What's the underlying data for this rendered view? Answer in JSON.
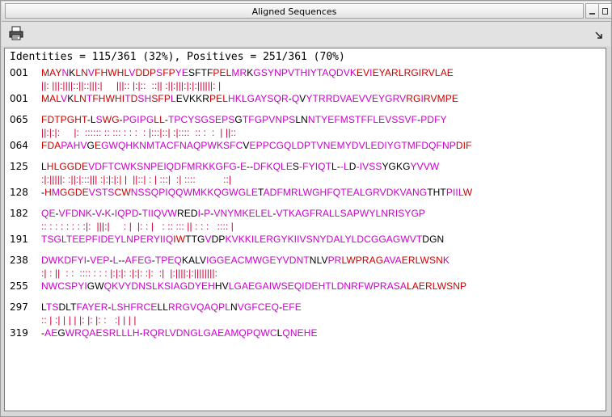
{
  "window": {
    "title": "Aligned Sequences"
  },
  "icons": {
    "print": "printer-icon",
    "minimize": "minimize-icon",
    "maximize": "maximize-icon",
    "close": "close-icon",
    "corner": "dock-arrow-icon"
  },
  "colors": {
    "identical": "#cc0000",
    "similar": "#cc00cc",
    "other": "#000000",
    "match_line": "#cc0033"
  },
  "summary": "Identities = 115/361 (32%), Positives = 251/361 (70%)",
  "blocks": [
    {
      "q_start": "001",
      "q_seq": "MAYNKLNVFHWHLVDDPSFPYESFTFPELMRKGSYNPVTHIYTAQDVKEVIEYARLRGIRVLAE",
      "q_cls": "RRRMBRRMRRRRRMRRRMRRMMBBBBRRRMMBMMMMMMMMMMMMMMMMRRMRRRRRRRRRRRRR",
      "match": "||: |||:||||::||::|||:|     |||:: |:|::  ::|| :||:|||:|:|:||||||: |",
      "s_start": "001",
      "s_seq": "MALVKLNTFHWHITDSHSFPLEVKKRPELHKLGAYSQR-QVYTRRDVAEVVEYGRVRGIRVMPE",
      "s_cls": "RRRMBRRMRRRRRMRMMRRRMBBBBBRRRMMMMMMMMMBMBMMMMMMMMMMMMMMMRRMRRRRR"
    },
    {
      "q_start": "065",
      "q_seq": "FDTPGHT-LSWG-PGIPGLL-TPCYSGSEPSGTFGPVNPSLNNTYEFMSTFFLEVSSVF-PDFY",
      "q_cls": "RRRRRRRBBMRRBMMMMMRRBMMMMMMMMMMBMMMMMMMMBBMMMMMMMMMMMMMMMMMBMMMM",
      "match": "||:|:|:     |:  :::::: :: ::: : : :  : |:::|::| :|::::  :: :  :  | ||::",
      "s_start": "064",
      "s_seq": "FDAPAHVGEGWQHKNMTACFNAQPWKSFCVEPPCGQLDPTVNEMYDVLEDIYGTMFDQFNPDIF",
      "s_cls": "RRRMMMMBRMMMMMMMMMMMMMMMMMMMMBMMMMMMMMMMMMMMMMMMMMMMMMMMMMMMMRRR"
    },
    {
      "q_start": "125",
      "q_seq": "LHLGGDEVDFTCWKSNPEIQDFMRKKGFG-E--DFKQLES-FYIQTL--LD-IVSSYGKGYVVW",
      "q_cls": "BRRRRRRMMMMMMMMMMMMMMMMMMMMMMBMBBMMMMMMBMMMMMMBBMMBMMMMMBBBBMMMM",
      "match": ":|:|||||: :||:|:::||| :|:|:|:| |  ||::| : | :::|  :| ::::          ::|",
      "s_start": "128",
      "s_seq": "-HMGGDEVSTSCWNSSQPIQQWMKKQGWGLETADFMRLWGHFQTEALGRVDKVANGTHTPIILW",
      "s_cls": "BRMRRRRMMMMRRMMMMMMMMMMMMMMMMMMBMMMMMMMMMMMMMMMMMMMMMMMMBBBMMMMR"
    },
    {
      "q_start": "182",
      "q_seq": "QE-VFDNK-V-K-IQPD-TIIQVWREDI-P-VNYMKELEL-VTKAGFRALLSAPWYLNRISYGP",
      "q_cls": "MMBMMMMMBMBMBMMMMBMMMMMMBBBMBMBMMMMMMMMMBMMMMMMMMMMMMMMMMMMMMMMM",
      "match": ":: : : : : : : :|:  |||:|     : |  |: : |   : :: ::: || : : :   :::: |",
      "s_start": "191",
      "s_seq": "TSGLTEEPFIDEYLNPERYIIQIWTTGVDPKVKKILERGYKIIVSNYDALYLDCGGAGWVTDGN",
      "s_cls": "MMMMMMMMMMMMMMMMMMMMMMRRBBBMBBMMMMMMMMMMMMMMMMMMMMMMMMMMMMMMMBBB"
    },
    {
      "q_start": "238",
      "q_seq": "DWKDFYI-VEP-L--AFEG-TPEQKALVIGGEACMWGEYVDNTNLVPRLWPRAGAVAERLWSNK",
      "q_cls": "MMMMMMMBMMMBMBBMMMMBMMMMBBBBMMMMMMMMMMMMMMMBBBMMRRRRRRMMMRRRRRRM",
      "match": ":| : ||  : :  :::: : : : |:|:|: :|:|: :|:  :|  |:||||:|:||||||||:",
      "s_start": "255",
      "s_seq": "NWCSPYIGWQKVYDNSLKSIAGDYEHHVLGAEGAIWSEQIDEHTLDNRFWPRASALAERLWSNP",
      "s_cls": "MMMMMMMBBMMMMMMMMMMMMMMMMMBBMMMMMMMMMMMMMMMMMMMMMMMMMMMRRRRRRRRR"
    },
    {
      "q_start": "297",
      "q_seq": "LTSDLTFAYER-LSHFRCELLRRGVQAQPLNVGFCEQ-EFE",
      "q_cls": "BMMBBBMMMMMBMMMMMMMBBMMMMMMMMMBMMMMMMBMMM",
      "match": ":: | :| | | | |: |: |: :   :| | | |",
      "s_start": "319",
      "s_seq": "-AEGWRQAESRLLLH-RQRLVDNGLGAEAMQPQWCLQNEHE",
      "s_cls": "BMMBMMMMMMMMMMMBMMMMMMMMMMMMMMMMMMMBMMMMM"
    }
  ]
}
